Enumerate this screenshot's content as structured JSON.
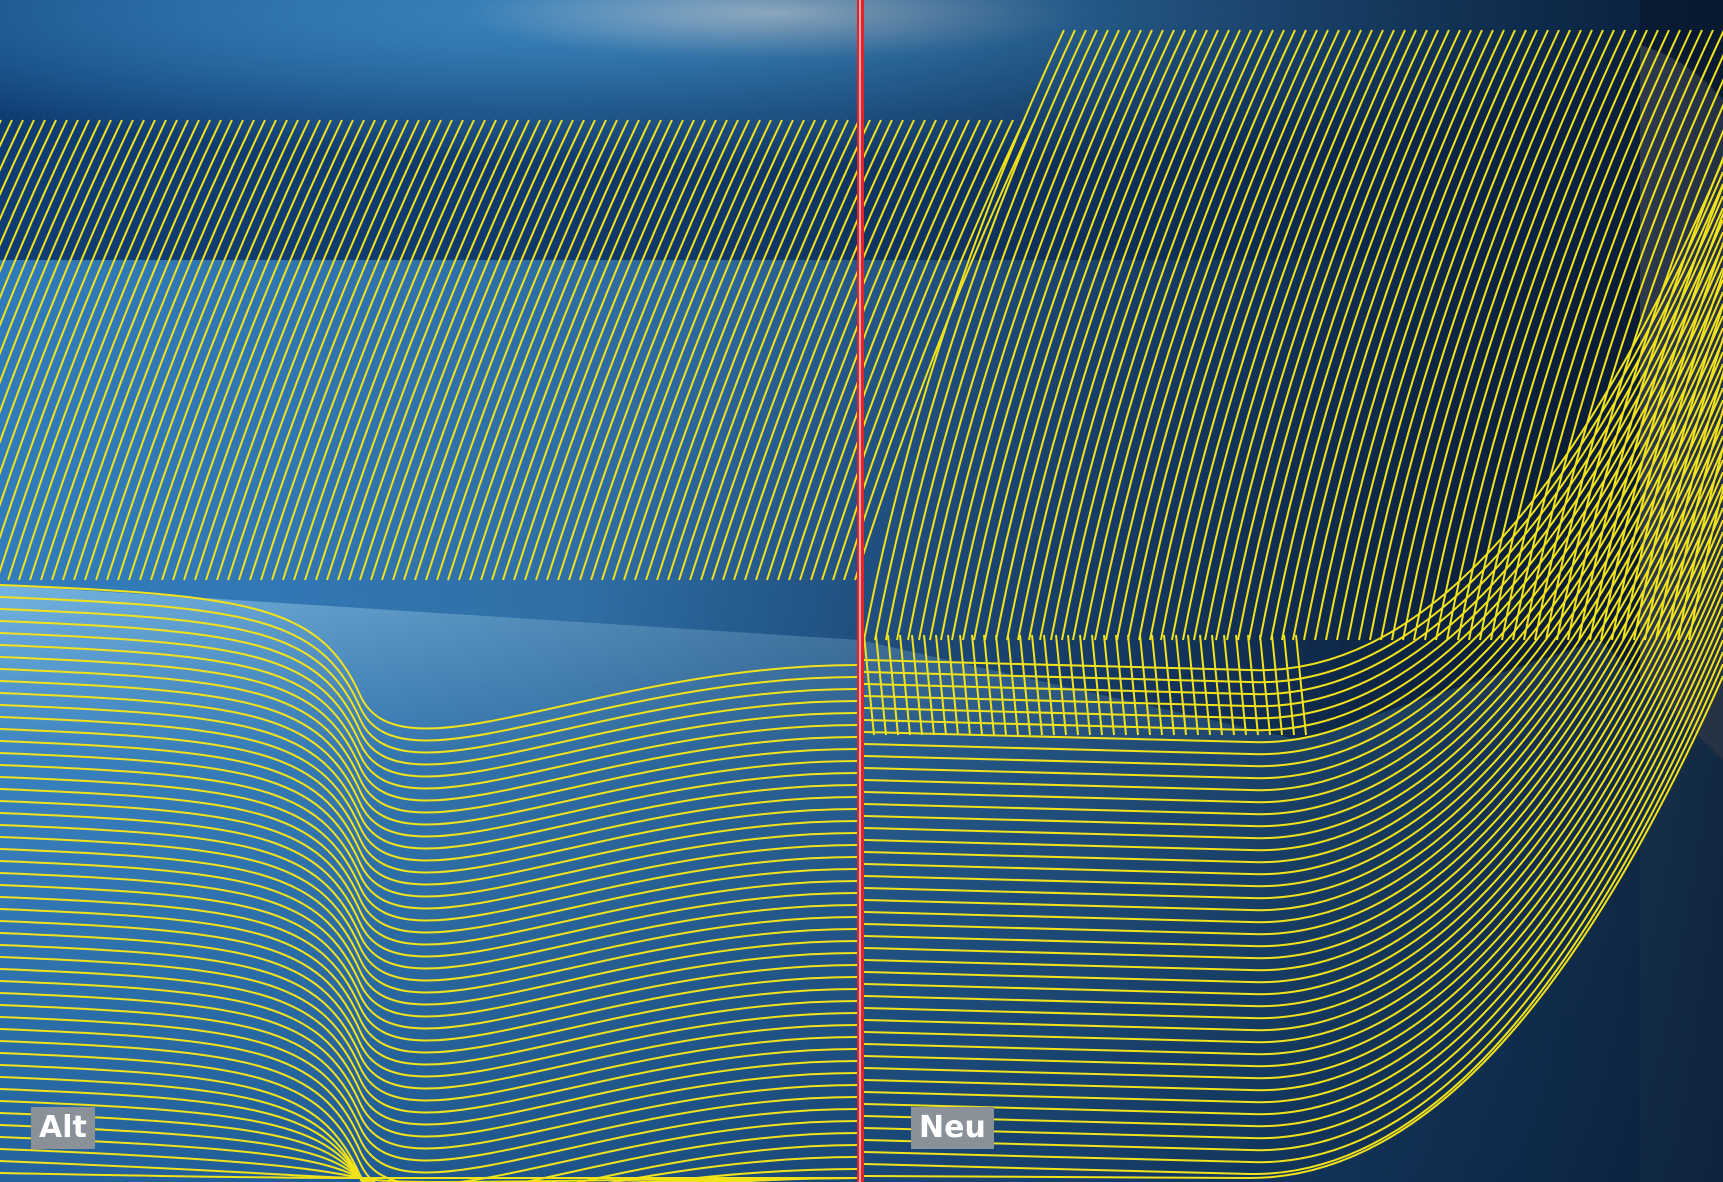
{
  "labels": {
    "old": "Alt",
    "new": "Neu"
  },
  "colors": {
    "toolpath": "#f2e21a",
    "divider": "#e3242b",
    "surface_dark": "#0f2f57",
    "surface_mid": "#2a73b5",
    "surface_light": "#9fd3f2",
    "label_bg": "#8a9198",
    "background_gray": "#c7cacd"
  }
}
